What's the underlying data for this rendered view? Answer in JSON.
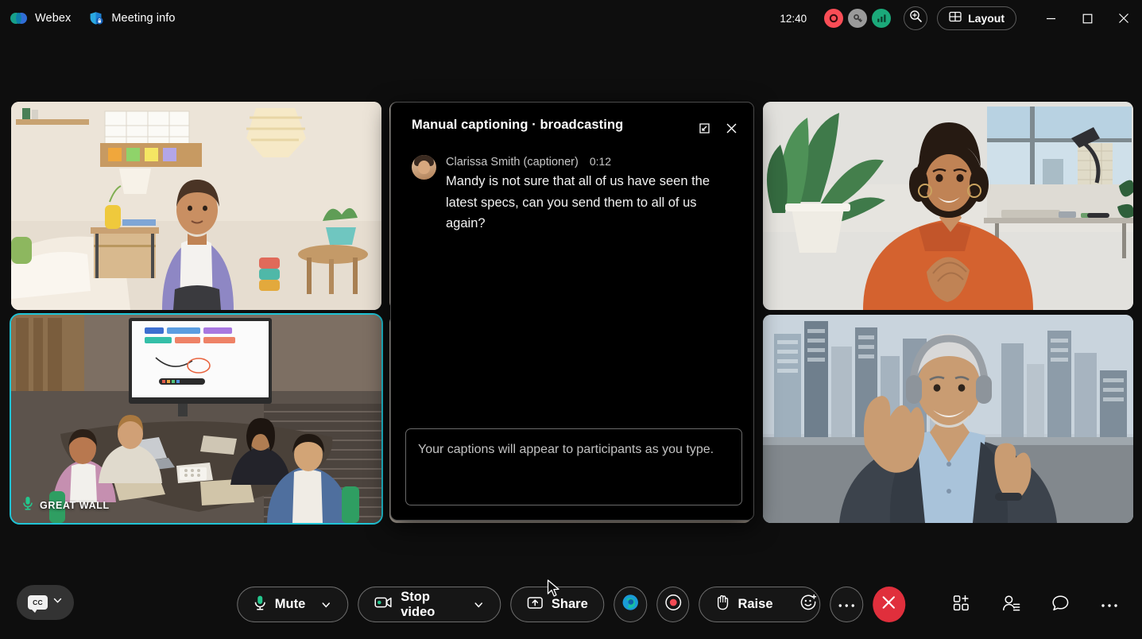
{
  "titlebar": {
    "app_name": "Webex",
    "meeting_info_label": "Meeting info",
    "clock": "12:40",
    "badges": [
      {
        "name": "recording-badge",
        "color": "#fa4d56"
      },
      {
        "name": "encryption-key-badge",
        "color": "#9a9a9a"
      },
      {
        "name": "network-quality-badge",
        "color": "#1ba97a"
      }
    ],
    "search_icon": "search-zoom-icon",
    "layout_label": "Layout",
    "window_minimize": "minimize",
    "window_maximize": "maximize",
    "window_close": "close"
  },
  "grid": {
    "tiles": [
      {
        "name": "participant-tile-1",
        "label": "",
        "active": false
      },
      {
        "name": "participant-tile-2",
        "label": "GREAT WALL",
        "active": true
      },
      {
        "name": "participant-tile-3",
        "label": "",
        "active": false
      },
      {
        "name": "participant-tile-4",
        "label": "",
        "active": false
      }
    ]
  },
  "caption_panel": {
    "title": "Manual captioning · broadcasting",
    "expand_icon": "expand-popout-icon",
    "close_icon": "close-icon",
    "message": {
      "author": "Clarissa Smith (captioner)",
      "time": "0:12",
      "text": "Mandy is not sure that all of us have seen the latest specs, can you send them to all of us again?"
    },
    "composer_placeholder": "Your captions will appear to participants as you type."
  },
  "controlbar": {
    "cc_label": "CC",
    "cc_caret": "chevron-down-icon",
    "mute_label": "Mute",
    "video_label": "Stop video",
    "share_label": "Share",
    "webex_assistant": "webex-assistant-icon",
    "record_button": "record-icon",
    "raise_label": "Raise",
    "reactions_icon": "emoji-reaction-icon",
    "more_options_icon": "more-options-icon",
    "leave_icon": "end-meeting-icon",
    "apps_icon": "apps-grid-icon",
    "participants_icon": "participants-icon",
    "chat_icon": "chat-bubble-icon",
    "more_icon": "more-horizontal-icon"
  },
  "colors": {
    "accent_green": "#24c78d",
    "active_border": "#1fc4d6",
    "hangup_red": "#e02f3c",
    "panel_bg": "#000000",
    "app_bg": "#0e0e0e"
  }
}
